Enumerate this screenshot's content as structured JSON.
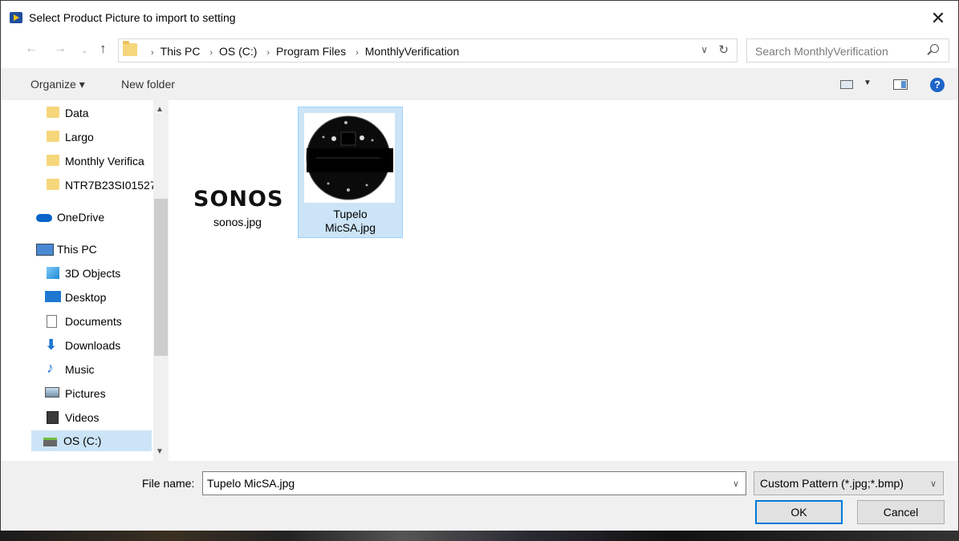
{
  "window": {
    "title": "Select Product Picture to import to setting"
  },
  "address": {
    "crumbs": [
      "This PC",
      "OS (C:)",
      "Program Files",
      "MonthlyVerification"
    ],
    "search_placeholder": "Search MonthlyVerification"
  },
  "toolbar": {
    "organize": "Organize ▾",
    "new_folder": "New folder"
  },
  "nav": {
    "items": [
      {
        "label": "Data",
        "icon": "folder-icon"
      },
      {
        "label": "Largo",
        "icon": "folder-icon"
      },
      {
        "label": "Monthly Verifica",
        "icon": "folder-icon"
      },
      {
        "label": "NTR7B23SI01527",
        "icon": "folder-icon"
      },
      {
        "label": "OneDrive",
        "icon": "cloud-icon"
      },
      {
        "label": "This PC",
        "icon": "computer-icon"
      },
      {
        "label": "3D Objects",
        "icon": "cube-icon"
      },
      {
        "label": "Desktop",
        "icon": "desktop-icon"
      },
      {
        "label": "Documents",
        "icon": "documents-icon"
      },
      {
        "label": "Downloads",
        "icon": "download-icon"
      },
      {
        "label": "Music",
        "icon": "music-icon"
      },
      {
        "label": "Pictures",
        "icon": "pictures-icon"
      },
      {
        "label": "Videos",
        "icon": "videos-icon"
      },
      {
        "label": "OS (C:)",
        "icon": "drive-icon"
      }
    ]
  },
  "files": [
    {
      "name": "sonos.jpg",
      "logo_text": "SONOS"
    },
    {
      "name": "Tupelo MicSA.jpg",
      "name_line1": "Tupelo",
      "name_line2": "MicSA.jpg"
    }
  ],
  "footer": {
    "file_name_label": "File name:",
    "file_name_value": "Tupelo MicSA.jpg",
    "filter_value": "Custom Pattern (*.jpg;*.bmp)",
    "ok_label": "OK",
    "cancel_label": "Cancel"
  },
  "colors": {
    "selection": "#cce4f7",
    "accent": "#0078d7",
    "folder": "#f6d67b"
  }
}
